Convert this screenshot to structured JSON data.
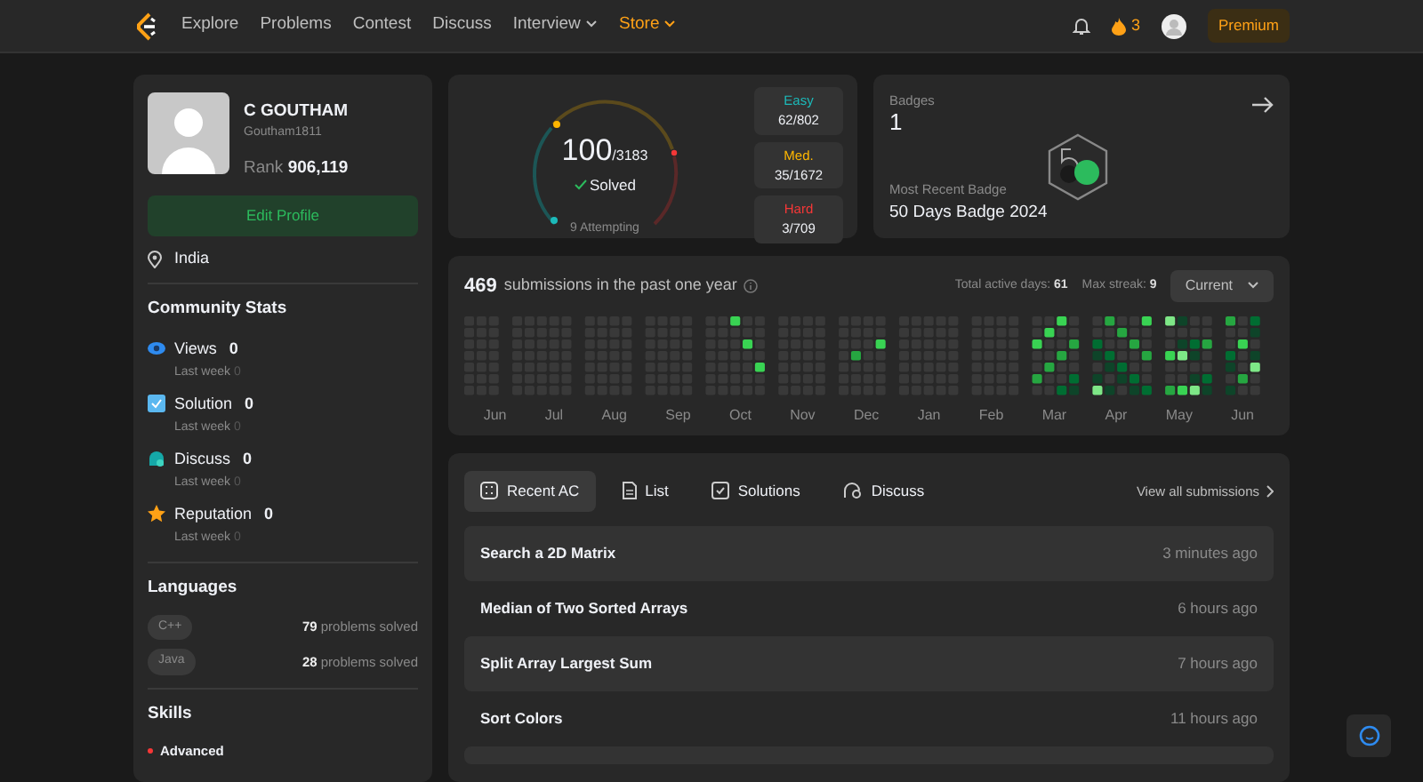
{
  "navbar": {
    "links": [
      {
        "label": "Explore",
        "dropdown": false,
        "highlight": false
      },
      {
        "label": "Problems",
        "dropdown": false,
        "highlight": false
      },
      {
        "label": "Contest",
        "dropdown": false,
        "highlight": false
      },
      {
        "label": "Discuss",
        "dropdown": false,
        "highlight": false
      },
      {
        "label": "Interview",
        "dropdown": true,
        "highlight": false
      },
      {
        "label": "Store",
        "dropdown": true,
        "highlight": true
      }
    ],
    "streak": "3",
    "premium": "Premium"
  },
  "profile": {
    "name": "C GOUTHAM",
    "username": "Goutham1811",
    "rank_label": "Rank",
    "rank": "906,119",
    "edit_button": "Edit Profile",
    "location": "India"
  },
  "community_stats": {
    "title": "Community Stats",
    "items": [
      {
        "kind": "views",
        "label": "Views",
        "value": "0",
        "sub": "Last week",
        "sub_value": "0"
      },
      {
        "kind": "solution",
        "label": "Solution",
        "value": "0",
        "sub": "Last week",
        "sub_value": "0"
      },
      {
        "kind": "discuss",
        "label": "Discuss",
        "value": "0",
        "sub": "Last week",
        "sub_value": "0"
      },
      {
        "kind": "reputation",
        "label": "Reputation",
        "value": "0",
        "sub": "Last week",
        "sub_value": "0"
      }
    ]
  },
  "languages": {
    "title": "Languages",
    "items": [
      {
        "name": "C++",
        "solved": "**79** problems solved"
      },
      {
        "name": "Java",
        "solved": "**28** problems solved"
      }
    ]
  },
  "skills": {
    "title": "Skills",
    "items": [
      {
        "label": "Advanced",
        "color": "#f63737"
      }
    ]
  },
  "solved": {
    "count": "100",
    "total": "/3183",
    "label": "Solved",
    "attempting": "9 Attempting",
    "difficulties": [
      {
        "label": "Easy",
        "value": "62/802",
        "color": "#1cbaba"
      },
      {
        "label": "Med.",
        "value": "35/1672",
        "color": "#ffb700"
      },
      {
        "label": "Hard",
        "value": "3/709",
        "color": "#f63737"
      }
    ]
  },
  "badges": {
    "title": "Badges",
    "count": "1",
    "recent_label": "Most Recent Badge",
    "recent": "50 Days Badge 2024"
  },
  "activity": {
    "count": "469",
    "text": "submissions in the past one year",
    "active_days_label": "Total active days:",
    "active_days": "61",
    "streak_label": "Max streak:",
    "streak": "9",
    "period": "Current",
    "months": [
      "Jun",
      "Jul",
      "Aug",
      "Sep",
      "Oct",
      "Nov",
      "Dec",
      "Jan",
      "Feb",
      "Mar",
      "Apr",
      "May",
      "Jun"
    ]
  },
  "recent": {
    "tabs": [
      {
        "label": "Recent AC",
        "kind": "recent",
        "selected": true
      },
      {
        "label": "List",
        "kind": "list",
        "selected": false
      },
      {
        "label": "Solutions",
        "kind": "solutions",
        "selected": false
      },
      {
        "label": "Discuss",
        "kind": "discuss",
        "selected": false
      }
    ],
    "view_all": "View all submissions",
    "rows": [
      {
        "title": "Search a 2D Matrix",
        "time": "3 minutes ago"
      },
      {
        "title": "Median of Two Sorted Arrays",
        "time": "6 hours ago"
      },
      {
        "title": "Split Array Largest Sum",
        "time": "7 hours ago"
      },
      {
        "title": "Sort Colors",
        "time": "11 hours ago"
      }
    ]
  }
}
